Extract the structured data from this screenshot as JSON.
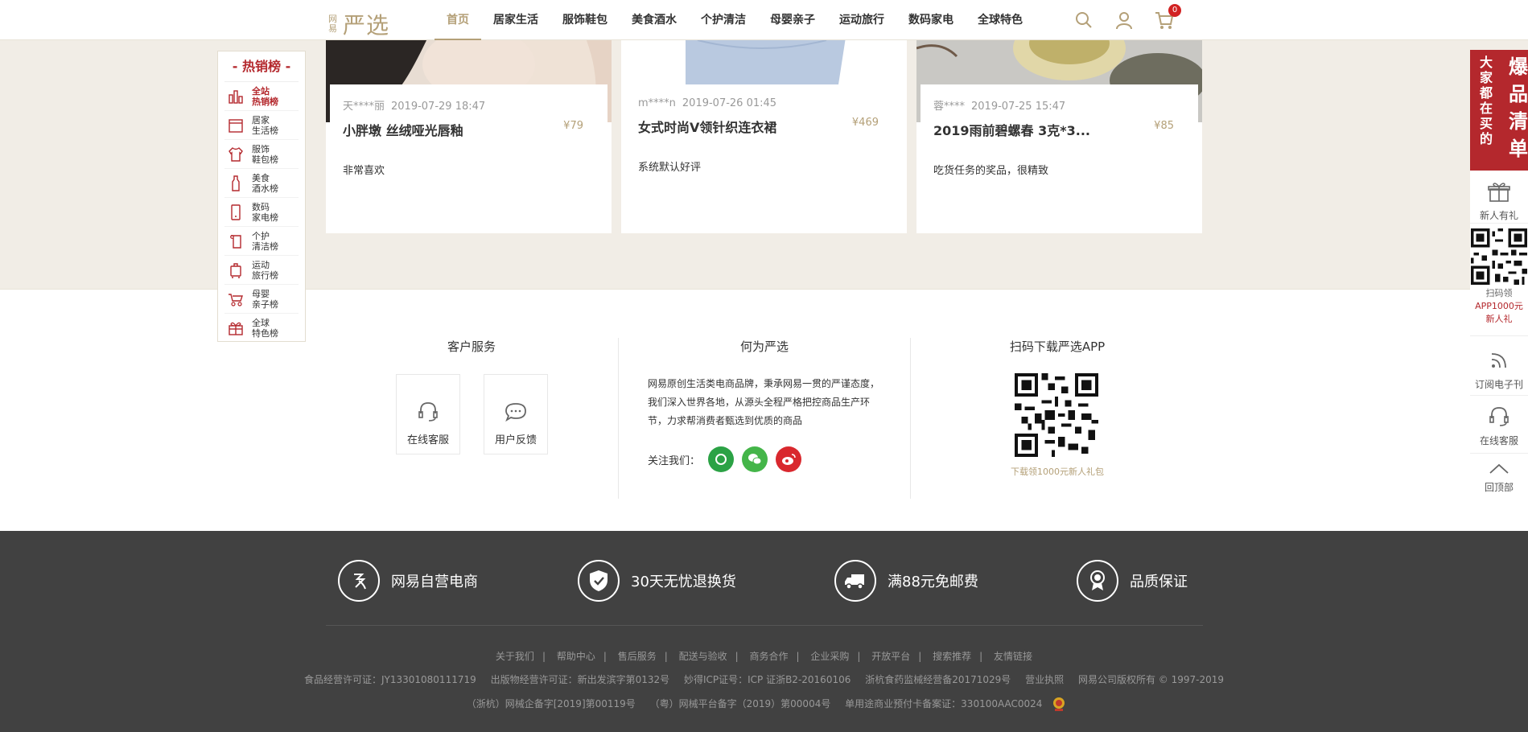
{
  "brand": {
    "small": "网易",
    "name": "严选"
  },
  "nav": {
    "items": [
      "首页",
      "居家生活",
      "服饰鞋包",
      "美食酒水",
      "个护清洁",
      "母婴亲子",
      "运动旅行",
      "数码家电",
      "全球特色"
    ],
    "cart_count": "0"
  },
  "reviews": [
    {
      "user": "天****丽",
      "time": "2019-07-29 18:47",
      "title": "小胖墩 丝绒哑光唇釉",
      "price": "¥79",
      "comment": "非常喜欢"
    },
    {
      "user": "m****n",
      "time": "2019-07-26 01:45",
      "title": "女式时尚V领针织连衣裙",
      "price": "¥469",
      "comment": "系统默认好评"
    },
    {
      "user": "蓉****",
      "time": "2019-07-25 15:47",
      "title": "2019雨前碧螺春 3克*3...",
      "price": "¥85",
      "comment": "吃货任务的奖品，很精致"
    }
  ],
  "rank": {
    "title": "- 热销榜 -",
    "items": [
      {
        "l1": "全站",
        "l2": "热销榜",
        "icon": "bar-chart-icon"
      },
      {
        "l1": "居家",
        "l2": "生活榜",
        "icon": "home-icon"
      },
      {
        "l1": "服饰",
        "l2": "鞋包榜",
        "icon": "shirt-icon"
      },
      {
        "l1": "美食",
        "l2": "酒水榜",
        "icon": "bottle-icon"
      },
      {
        "l1": "数码",
        "l2": "家电榜",
        "icon": "phone-icon"
      },
      {
        "l1": "个护",
        "l2": "清洁榜",
        "icon": "towel-icon"
      },
      {
        "l1": "运动",
        "l2": "旅行榜",
        "icon": "luggage-icon"
      },
      {
        "l1": "母婴",
        "l2": "亲子榜",
        "icon": "stroller-icon"
      },
      {
        "l1": "全球",
        "l2": "特色榜",
        "icon": "gift-icon"
      }
    ]
  },
  "side": {
    "promo_col1": "大家都在买的",
    "promo_col2": "爆品清单",
    "newcomer": "新人有礼",
    "qr_label": "扫码领",
    "qr_red1": "APP1000元",
    "qr_red2": "新人礼",
    "subscribe": "订阅电子刊",
    "service": "在线客服",
    "top": "回顶部"
  },
  "service": {
    "title": "客户服务",
    "online": "在线客服",
    "feedback": "用户反馈"
  },
  "about": {
    "title": "何为严选",
    "text": "网易原创生活类电商品牌，秉承网易一贯的严谨态度，我们深入世界各地，从源头全程严格把控商品生产环节，力求帮消费者甄选到优质的商品",
    "follow": "关注我们："
  },
  "app": {
    "title": "扫码下载严选APP",
    "caption": "下载领1000元新人礼包"
  },
  "promises": [
    "网易自营电商",
    "30天无忧退换货",
    "满88元免邮费",
    "品质保证"
  ],
  "links": [
    "关于我们",
    "帮助中心",
    "售后服务",
    "配送与验收",
    "商务合作",
    "企业采购",
    "开放平台",
    "搜索推荐",
    "友情链接"
  ],
  "licenses1": [
    "食品经营许可证：JY13301080111719",
    "出版物经营许可证：新出发滨字第0132号",
    "妙得ICP证号：ICP 证浙B2-20160106",
    "浙杭食药监械经营备20171029号",
    "营业执照",
    "网易公司版权所有 © 1997-2019"
  ],
  "licenses2": [
    "（浙杭）网械企备字[2019]第00119号",
    "（粤）网械平台备字（2019）第00004号",
    "单用途商业预付卡备案证：330100AAC0024"
  ],
  "colors": {
    "accent": "#b4a078",
    "red": "#b4282d",
    "footer": "#414141",
    "band": "#f1ede6"
  }
}
